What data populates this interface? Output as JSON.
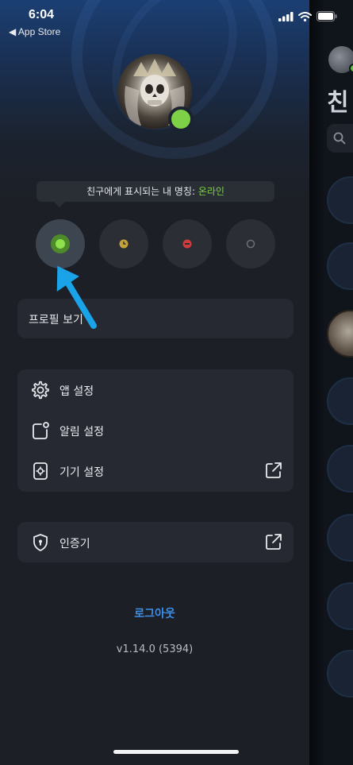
{
  "status_bar": {
    "time": "6:04",
    "back_app": "◀ App Store",
    "signal_icon": "cellular-signal-icon",
    "wifi_icon": "wifi-icon",
    "battery_icon": "battery-icon"
  },
  "profile": {
    "avatar_icon": "skull-king-avatar",
    "status_color": "#7ed146"
  },
  "status_picker": {
    "prefix": "친구에게 표시되는 내 명칭: ",
    "current_status": "온라인",
    "options": [
      {
        "name": "online",
        "selected": true,
        "color": "#8ee04c"
      },
      {
        "name": "away",
        "selected": false,
        "color": "#c7a23a"
      },
      {
        "name": "busy",
        "selected": false,
        "color": "#d23b3b"
      },
      {
        "name": "offline",
        "selected": false,
        "color": "#6b6f76"
      }
    ]
  },
  "menu": {
    "view_profile": "프로필 보기",
    "app_settings": "앱 설정",
    "notification_settings": "알림 설정",
    "device_settings": "기기 설정",
    "authenticator": "인증기"
  },
  "footer": {
    "logout": "로그아웃",
    "version": "v1.14.0 (5394)"
  },
  "behind_panel": {
    "title": "친",
    "search_icon": "search-icon"
  },
  "colors": {
    "accent_blue": "#3e8fe8",
    "online_green": "#7ed146",
    "annotation_arrow": "#1aa3e8"
  }
}
